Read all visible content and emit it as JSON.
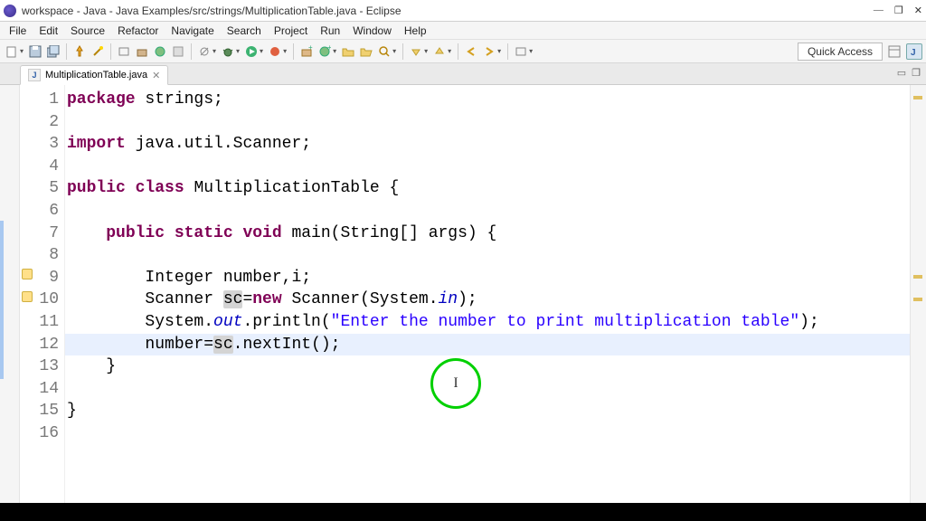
{
  "titlebar": {
    "text": "workspace - Java - Java Examples/src/strings/MultiplicationTable.java - Eclipse"
  },
  "win": {
    "min": "—",
    "max": "❐",
    "close": "✕"
  },
  "menu": {
    "items": [
      "File",
      "Edit",
      "Source",
      "Refactor",
      "Navigate",
      "Search",
      "Project",
      "Run",
      "Window",
      "Help"
    ]
  },
  "toolbar_right": {
    "quick_access": "Quick Access"
  },
  "tab": {
    "label": "MultiplicationTable.java",
    "j": "J"
  },
  "code": {
    "lines": [
      {
        "n": "1",
        "tokens": [
          {
            "t": "package ",
            "c": "tok-kw"
          },
          {
            "t": "strings;",
            "c": ""
          }
        ]
      },
      {
        "n": "2",
        "tokens": []
      },
      {
        "n": "3",
        "tokens": [
          {
            "t": "import ",
            "c": "tok-kw"
          },
          {
            "t": "java.util.Scanner;",
            "c": ""
          }
        ]
      },
      {
        "n": "4",
        "tokens": []
      },
      {
        "n": "5",
        "tokens": [
          {
            "t": "public class ",
            "c": "tok-kw"
          },
          {
            "t": "MultiplicationTable {",
            "c": ""
          }
        ]
      },
      {
        "n": "6",
        "tokens": []
      },
      {
        "n": "7",
        "tokens": [
          {
            "t": "    ",
            "c": ""
          },
          {
            "t": "public static void ",
            "c": "tok-kw"
          },
          {
            "t": "main(String[] ",
            "c": ""
          },
          {
            "t": "args",
            "c": ""
          },
          {
            "t": ") {",
            "c": ""
          }
        ]
      },
      {
        "n": "8",
        "tokens": []
      },
      {
        "n": "9",
        "tokens": [
          {
            "t": "        Integer ",
            "c": ""
          },
          {
            "t": "number",
            "c": ""
          },
          {
            "t": ",",
            "c": ""
          },
          {
            "t": "i",
            "c": ""
          },
          {
            "t": ";",
            "c": ""
          }
        ]
      },
      {
        "n": "10",
        "tokens": [
          {
            "t": "        Scanner ",
            "c": ""
          },
          {
            "t": "sc",
            "c": "tok-hl-var"
          },
          {
            "t": "=",
            "c": ""
          },
          {
            "t": "new ",
            "c": "tok-kw"
          },
          {
            "t": "Scanner(System.",
            "c": ""
          },
          {
            "t": "in",
            "c": "tok-field"
          },
          {
            "t": ");",
            "c": ""
          }
        ]
      },
      {
        "n": "11",
        "tokens": [
          {
            "t": "        System.",
            "c": ""
          },
          {
            "t": "out",
            "c": "tok-field"
          },
          {
            "t": ".println(",
            "c": ""
          },
          {
            "t": "\"Enter the number to print multiplication table\"",
            "c": "tok-str"
          },
          {
            "t": ");",
            "c": ""
          }
        ]
      },
      {
        "n": "12",
        "hl": true,
        "tokens": [
          {
            "t": "        ",
            "c": ""
          },
          {
            "t": "number",
            "c": ""
          },
          {
            "t": "=",
            "c": ""
          },
          {
            "t": "sc",
            "c": "tok-hl-var"
          },
          {
            "t": ".nextInt();",
            "c": ""
          }
        ]
      },
      {
        "n": "13",
        "tokens": [
          {
            "t": "    }",
            "c": ""
          }
        ]
      },
      {
        "n": "14",
        "tokens": []
      },
      {
        "n": "15",
        "tokens": [
          {
            "t": "}",
            "c": ""
          }
        ]
      },
      {
        "n": "16",
        "tokens": []
      }
    ]
  },
  "cursor_ring": {
    "label": "I"
  }
}
